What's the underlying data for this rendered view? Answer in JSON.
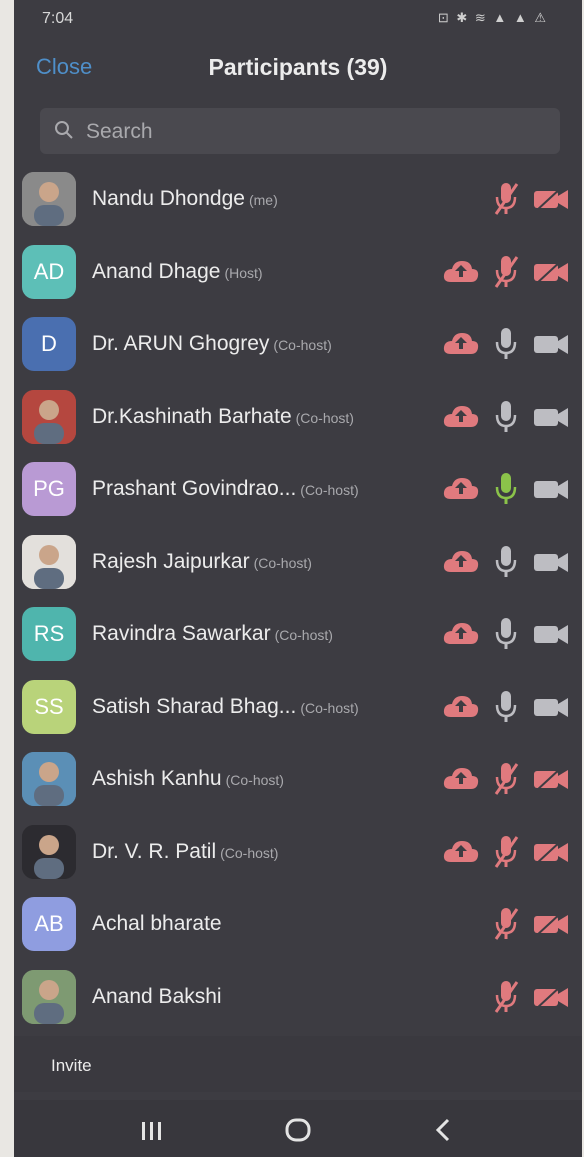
{
  "status_bar": {
    "time": "7:04",
    "icons": "⊡ ✱ ≋ ▲ ▲ ⚠"
  },
  "header": {
    "close_label": "Close",
    "title": "Participants (39)"
  },
  "search": {
    "placeholder": "Search"
  },
  "participants": [
    {
      "name": "Nandu Dhondge",
      "role": "(me)",
      "avatar_initials": "",
      "avatar_color": "#8a8a8a",
      "cloud": false,
      "mic": "muted",
      "video": "off"
    },
    {
      "name": "Anand Dhage",
      "role": "(Host)",
      "avatar_initials": "AD",
      "avatar_color": "#5dbfb7",
      "cloud": true,
      "mic": "muted",
      "video": "off"
    },
    {
      "name": "Dr. ARUN Ghogrey",
      "role": "(Co-host)",
      "avatar_initials": "D",
      "avatar_color": "#4a6fb0",
      "cloud": true,
      "mic": "on",
      "video": "on"
    },
    {
      "name": "Dr.Kashinath Barhate",
      "role": "(Co-host)",
      "avatar_initials": "",
      "avatar_color": "#b5473f",
      "cloud": true,
      "mic": "on",
      "video": "on"
    },
    {
      "name": "Prashant Govindrao...",
      "role": "(Co-host)",
      "avatar_initials": "PG",
      "avatar_color": "#b99ad4",
      "cloud": true,
      "mic": "speaking",
      "video": "on"
    },
    {
      "name": "Rajesh Jaipurkar",
      "role": "(Co-host)",
      "avatar_initials": "",
      "avatar_color": "#e3e0dc",
      "cloud": true,
      "mic": "on",
      "video": "on"
    },
    {
      "name": "Ravindra Sawarkar",
      "role": "(Co-host)",
      "avatar_initials": "RS",
      "avatar_color": "#4fb5ad",
      "cloud": true,
      "mic": "on",
      "video": "on"
    },
    {
      "name": "Satish Sharad Bhag...",
      "role": "(Co-host)",
      "avatar_initials": "SS",
      "avatar_color": "#b9d37a",
      "cloud": true,
      "mic": "on",
      "video": "on"
    },
    {
      "name": "Ashish Kanhu",
      "role": "(Co-host)",
      "avatar_initials": "",
      "avatar_color": "#5b8fb6",
      "cloud": true,
      "mic": "muted",
      "video": "off"
    },
    {
      "name": "Dr. V. R. Patil",
      "role": "(Co-host)",
      "avatar_initials": "",
      "avatar_color": "#2c2b30",
      "cloud": true,
      "mic": "muted",
      "video": "off"
    },
    {
      "name": "Achal bharate",
      "role": "",
      "avatar_initials": "AB",
      "avatar_color": "#8f9de0",
      "cloud": false,
      "mic": "muted",
      "video": "off"
    },
    {
      "name": "Anand Bakshi",
      "role": "",
      "avatar_initials": "",
      "avatar_color": "#7e9a72",
      "cloud": false,
      "mic": "muted",
      "video": "off"
    }
  ],
  "footer": {
    "invite_label": "Invite"
  },
  "colors": {
    "accent": "#4f8fc9",
    "muted_red": "#e07a7e",
    "icon_grey": "#bdbdc2",
    "speaking_green": "#8bc34a"
  }
}
